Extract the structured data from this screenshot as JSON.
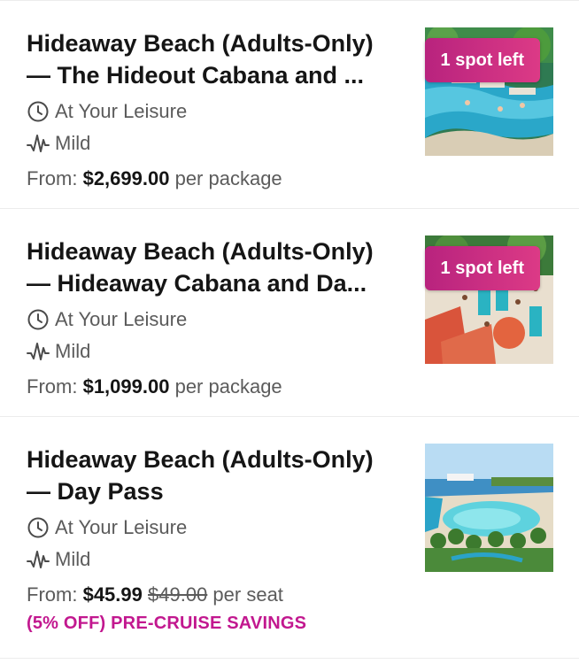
{
  "colors": {
    "accent": "#c2188f",
    "badge_start": "#b8237e",
    "badge_end": "#dc3a86",
    "muted_text": "#5b5b5b",
    "divider": "#ececec"
  },
  "items": [
    {
      "title_line1": "Hideaway Beach (Adults-Only)",
      "title_line2": "— The Hideout Cabana and ...",
      "duration": "At Your Leisure",
      "duration_icon": "clock-icon",
      "intensity": "Mild",
      "intensity_icon": "activity-wave-icon",
      "price_prefix": "From:",
      "price": "$2,699.00",
      "price_unit": "per package",
      "badge": "1 spot left",
      "image": "pool-aerial-image"
    },
    {
      "title_line1": "Hideaway Beach (Adults-Only)",
      "title_line2": "— Hideaway Cabana and Da...",
      "duration": "At Your Leisure",
      "duration_icon": "clock-icon",
      "intensity": "Mild",
      "intensity_icon": "activity-wave-icon",
      "price_prefix": "From:",
      "price": "$1,099.00",
      "price_unit": "per package",
      "badge": "1 spot left",
      "image": "beach-umbrellas-image"
    },
    {
      "title_line1": "Hideaway Beach (Adults-Only)",
      "title_line2": "— Day Pass",
      "duration": "At Your Leisure",
      "duration_icon": "clock-icon",
      "intensity": "Mild",
      "intensity_icon": "activity-wave-icon",
      "price_prefix": "From:",
      "price": "$45.99",
      "price_old": "$49.00",
      "price_unit": "per seat",
      "promo": "(5% OFF) PRE-CRUISE SAVINGS",
      "image": "island-lagoon-image"
    }
  ]
}
